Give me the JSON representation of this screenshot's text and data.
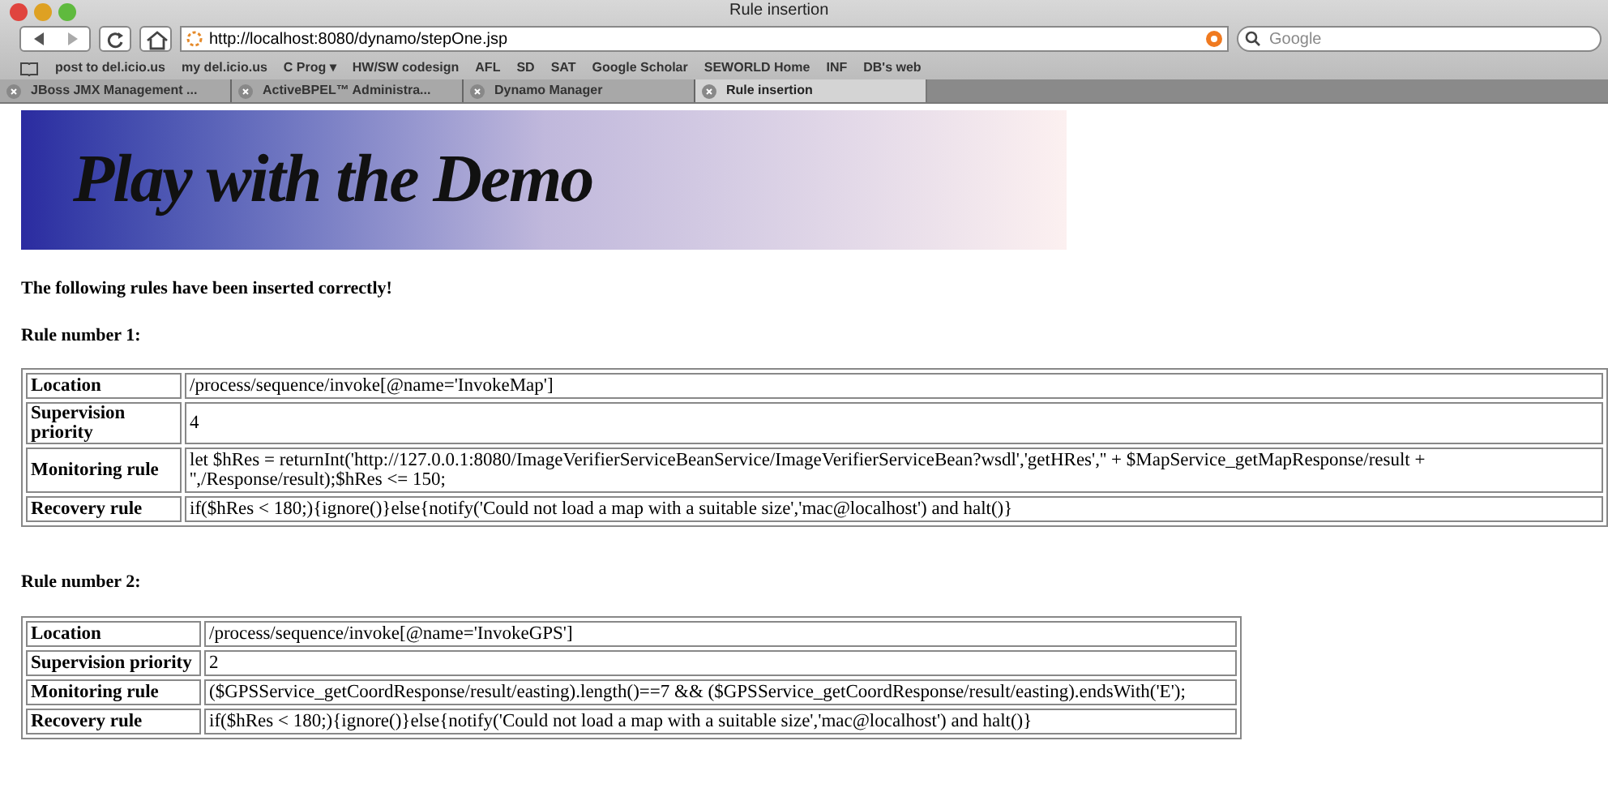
{
  "window": {
    "title": "Rule insertion"
  },
  "toolbar": {
    "url": "http://localhost:8080/dynamo/stepOne.jsp",
    "search_placeholder": "Google"
  },
  "bookmarks": [
    "post to del.icio.us",
    "my del.icio.us",
    "C Prog ▾",
    "HW/SW codesign",
    "AFL",
    "SD",
    "SAT",
    "Google Scholar",
    "SEWORLD Home",
    "INF",
    "DB's web"
  ],
  "tabs": [
    {
      "label": "JBoss JMX Management ...",
      "selected": false
    },
    {
      "label": "ActiveBPEL™ Administra...",
      "selected": false
    },
    {
      "label": "Dynamo Manager",
      "selected": false
    },
    {
      "label": "Rule insertion",
      "selected": true
    }
  ],
  "banner": {
    "title": "Play with the Demo"
  },
  "message": "The following rules have been inserted correctly!",
  "rules": [
    {
      "heading": "Rule number 1:",
      "rows": [
        {
          "label": "Location",
          "value": "/process/sequence/invoke[@name='InvokeMap']"
        },
        {
          "label": "Supervision priority",
          "value": "4"
        },
        {
          "label": "Monitoring rule",
          "value": "let $hRes = returnInt('http://127.0.0.1:8080/ImageVerifierServiceBeanService/ImageVerifierServiceBean?wsdl','getHRes','' + $MapService_getMapResponse/result + '',/Response/result);$hRes <= 150;"
        },
        {
          "label": "Recovery rule",
          "value": "if($hRes < 180;){ignore()}else{notify('Could not load a map with a suitable size','mac@localhost') and halt()}"
        }
      ]
    },
    {
      "heading": "Rule number 2:",
      "rows": [
        {
          "label": "Location",
          "value": "/process/sequence/invoke[@name='InvokeGPS']"
        },
        {
          "label": "Supervision priority",
          "value": "2"
        },
        {
          "label": "Monitoring rule",
          "value": "($GPSService_getCoordResponse/result/easting).length()==7 && ($GPSService_getCoordResponse/result/easting).endsWith('E');"
        },
        {
          "label": "Recovery rule",
          "value": "if($hRes < 180;){ignore()}else{notify('Could not load a map with a suitable size','mac@localhost') and halt()}"
        }
      ]
    }
  ]
}
